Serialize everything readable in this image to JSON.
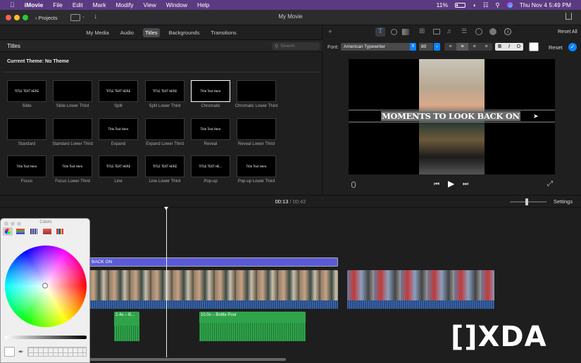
{
  "menubar": {
    "app": "iMovie",
    "items": [
      "File",
      "Edit",
      "Mark",
      "Modify",
      "View",
      "Window",
      "Help"
    ],
    "battery": "11%",
    "clock": "Thu Nov 4  5:49 PM"
  },
  "toolbar": {
    "projects_label": "Projects",
    "window_title": "My Movie"
  },
  "media_tabs": [
    "My Media",
    "Audio",
    "Titles",
    "Backgrounds",
    "Transitions"
  ],
  "titles_browser": {
    "heading": "Titles",
    "search_placeholder": "Search",
    "current_theme": "Current Theme: No Theme",
    "items": [
      {
        "label": "Slide",
        "preview": "TITLE TEXT HERE"
      },
      {
        "label": "Slide Lower Third",
        "preview": ""
      },
      {
        "label": "Split",
        "preview": "TITLE TEXT HERE"
      },
      {
        "label": "Split Lower Third",
        "preview": "TITLE TEXT HERE"
      },
      {
        "label": "Chromatic",
        "preview": "Title Text Here"
      },
      {
        "label": "Chromatic Lower Third",
        "preview": ""
      },
      {
        "label": "Standard",
        "preview": ""
      },
      {
        "label": "Standard Lower Third",
        "preview": ""
      },
      {
        "label": "Expand",
        "preview": "Title Text Here"
      },
      {
        "label": "Expand Lower Third",
        "preview": ""
      },
      {
        "label": "Reveal",
        "preview": "Title Text Here"
      },
      {
        "label": "Reveal Lower Third",
        "preview": ""
      },
      {
        "label": "Focus",
        "preview": "Title Text Here"
      },
      {
        "label": "Focus Lower Third",
        "preview": "Title Text Here"
      },
      {
        "label": "Line",
        "preview": "TITLE TEXT HERE"
      },
      {
        "label": "Line Lower Third",
        "preview": "TITLE TEXT HERE"
      },
      {
        "label": "Pop-up",
        "preview": "TITLE TEXT HE..."
      },
      {
        "label": "Pop-up Lower Third",
        "preview": "Title Text Here"
      }
    ]
  },
  "inspector": {
    "reset_all": "Reset All",
    "font_label": "Font:",
    "font_value": "American Typewriter",
    "font_size": "80",
    "bold": "B",
    "italic": "I",
    "outline": "O",
    "reset": "Reset"
  },
  "viewer": {
    "title_overlay": "MOMENTS TO LOOK BACK ON"
  },
  "timecode": {
    "current": "00:13",
    "separator": "/",
    "total": "00:42"
  },
  "timeline": {
    "settings": "Settings",
    "title_clip": "BACK ON",
    "audio_clips": [
      "2.4s – B...",
      "10.0s – Bottle Pour"
    ]
  },
  "color_panel": {
    "title": "Colors"
  },
  "watermark": "[]XDA",
  "colors": {
    "menubar": "#5b3a82",
    "title_clip": "#5b5bd6",
    "audio_clip": "#2fa34a",
    "accent": "#0a84ff"
  }
}
